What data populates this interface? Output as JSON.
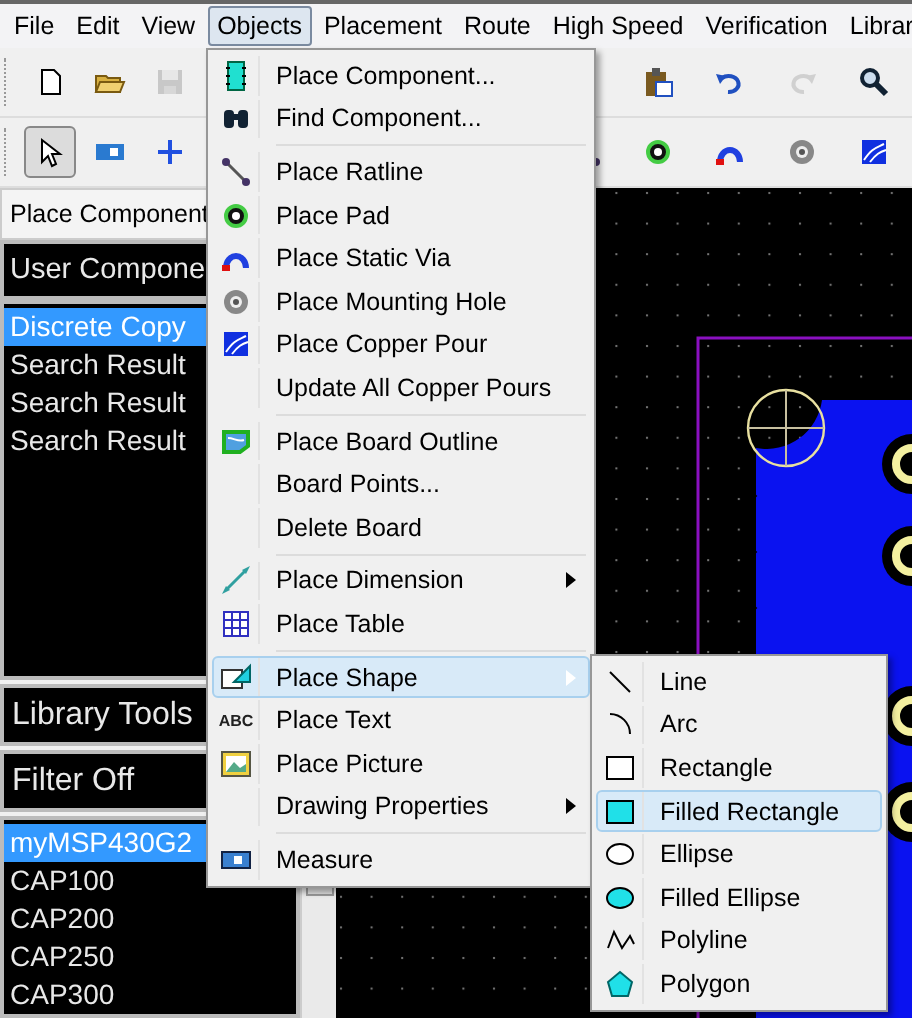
{
  "menubar": [
    {
      "label": "File",
      "selected": false
    },
    {
      "label": "Edit",
      "selected": false
    },
    {
      "label": "View",
      "selected": false
    },
    {
      "label": "Objects",
      "selected": true
    },
    {
      "label": "Placement",
      "selected": false
    },
    {
      "label": "Route",
      "selected": false
    },
    {
      "label": "High Speed",
      "selected": false
    },
    {
      "label": "Verification",
      "selected": false
    },
    {
      "label": "Librar",
      "selected": false
    }
  ],
  "toolbar_1": {
    "left": [
      {
        "kind": "new",
        "disabled": false
      },
      {
        "kind": "open",
        "disabled": false
      },
      {
        "kind": "save",
        "disabled": true
      }
    ],
    "right": [
      {
        "kind": "paste",
        "disabled": false
      },
      {
        "kind": "undo",
        "disabled": false
      },
      {
        "kind": "redo",
        "disabled": true
      },
      {
        "kind": "zoom",
        "disabled": false
      }
    ]
  },
  "toolbar_2": {
    "left": [
      {
        "kind": "select",
        "pressed": true
      },
      {
        "kind": "component",
        "pressed": false
      },
      {
        "kind": "add",
        "pressed": false
      }
    ],
    "right": [
      {
        "kind": "ratline",
        "pressed": false
      },
      {
        "kind": "pad",
        "pressed": false
      },
      {
        "kind": "via",
        "pressed": false
      },
      {
        "kind": "hole",
        "pressed": false
      },
      {
        "kind": "pour",
        "pressed": false
      }
    ]
  },
  "left_panel": {
    "tab": "Place Component",
    "header": "User Compone",
    "groups": [
      {
        "label": "Discrete Copy",
        "selected": true
      },
      {
        "label": "Search Result",
        "selected": false
      },
      {
        "label": "Search Result",
        "selected": false
      },
      {
        "label": "Search Result",
        "selected": false
      }
    ],
    "library_tools": "Library Tools",
    "filter": "Filter Off",
    "parts": [
      {
        "label": "myMSP430G2",
        "selected": true
      },
      {
        "label": "CAP100",
        "selected": false
      },
      {
        "label": "CAP200",
        "selected": false
      },
      {
        "label": "CAP250",
        "selected": false
      },
      {
        "label": "CAP300",
        "selected": false
      }
    ]
  },
  "objects_menu": [
    {
      "kind": "item",
      "label": "Place Component...",
      "submenu": false,
      "selected": false
    },
    {
      "kind": "item",
      "label": "Find Component...",
      "submenu": false,
      "selected": false
    },
    {
      "kind": "separator"
    },
    {
      "kind": "item",
      "label": "Place Ratline",
      "submenu": false,
      "selected": false
    },
    {
      "kind": "item",
      "label": "Place Pad",
      "submenu": false,
      "selected": false
    },
    {
      "kind": "item",
      "label": "Place Static Via",
      "submenu": false,
      "selected": false
    },
    {
      "kind": "item",
      "label": "Place Mounting Hole",
      "submenu": false,
      "selected": false
    },
    {
      "kind": "item",
      "label": "Place Copper Pour",
      "submenu": false,
      "selected": false
    },
    {
      "kind": "item",
      "label": "Update All Copper Pours",
      "submenu": false,
      "selected": false
    },
    {
      "kind": "separator"
    },
    {
      "kind": "item",
      "label": "Place Board Outline",
      "submenu": false,
      "selected": false
    },
    {
      "kind": "item",
      "label": "Board Points...",
      "submenu": false,
      "selected": false
    },
    {
      "kind": "item",
      "label": "Delete Board",
      "submenu": false,
      "selected": false
    },
    {
      "kind": "separator"
    },
    {
      "kind": "item",
      "label": "Place Dimension",
      "submenu": true,
      "selected": false
    },
    {
      "kind": "item",
      "label": "Place Table",
      "submenu": false,
      "selected": false
    },
    {
      "kind": "separator"
    },
    {
      "kind": "item",
      "label": "Place Shape",
      "submenu": true,
      "selected": true
    },
    {
      "kind": "item",
      "label": "Place Text",
      "submenu": false,
      "selected": false,
      "icon_text": "ABC"
    },
    {
      "kind": "item",
      "label": "Place Picture",
      "submenu": false,
      "selected": false
    },
    {
      "kind": "item",
      "label": "Drawing Properties",
      "submenu": true,
      "selected": false
    },
    {
      "kind": "separator"
    },
    {
      "kind": "item",
      "label": "Measure",
      "submenu": false,
      "selected": false
    }
  ],
  "shape_submenu": [
    {
      "label": "Line",
      "selected": false
    },
    {
      "label": "Arc",
      "selected": false
    },
    {
      "label": "Rectangle",
      "selected": false
    },
    {
      "label": "Filled Rectangle",
      "selected": true
    },
    {
      "label": "Ellipse",
      "selected": false
    },
    {
      "label": "Filled Ellipse",
      "selected": false
    },
    {
      "label": "Polyline",
      "selected": false
    },
    {
      "label": "Polygon",
      "selected": false
    }
  ]
}
